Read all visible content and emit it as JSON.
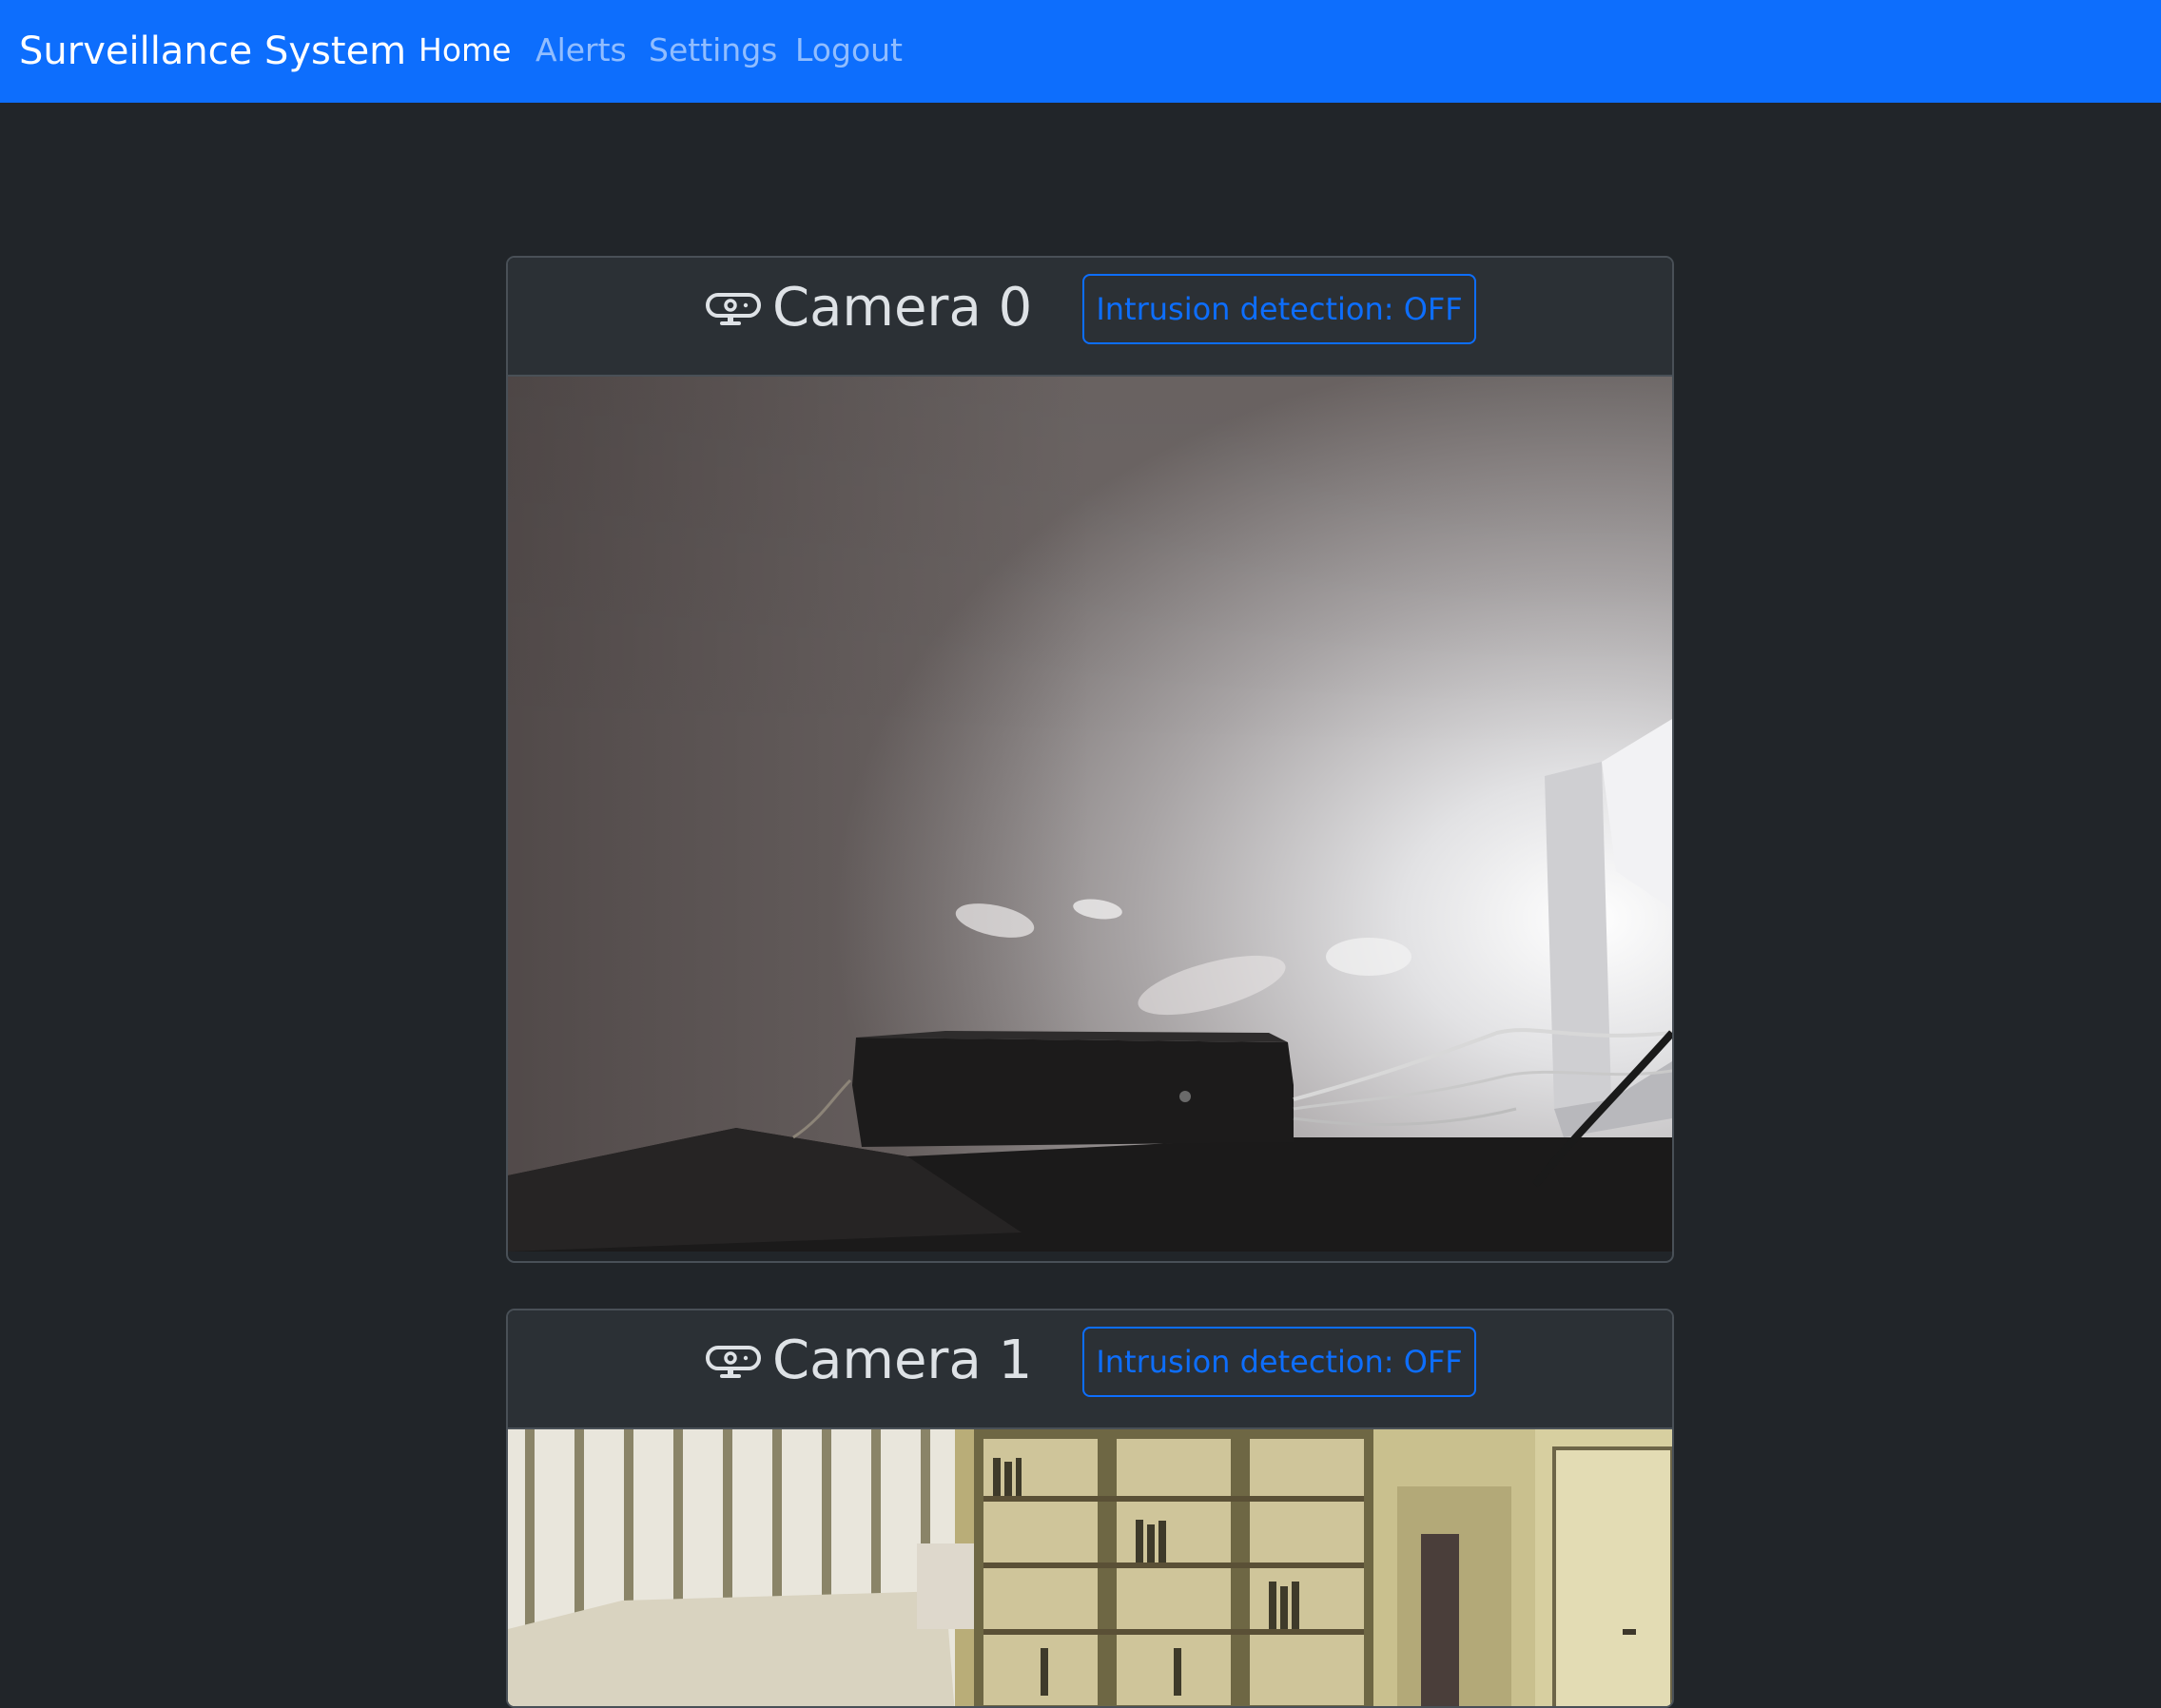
{
  "navbar": {
    "brand": "Surveillance System",
    "links": [
      {
        "label": "Home",
        "active": true
      },
      {
        "label": "Alerts",
        "active": false
      },
      {
        "label": "Settings",
        "active": false
      },
      {
        "label": "Logout",
        "active": false
      }
    ],
    "background_color": "#0d6efd"
  },
  "cameras": [
    {
      "title": "Camera 0",
      "icon": "webcam-icon",
      "intrusion_button_label": "Intrusion detection: OFF",
      "feed_description_icon": "camera-feed-image"
    },
    {
      "title": "Camera 1",
      "icon": "webcam-icon",
      "intrusion_button_label": "Intrusion detection: OFF",
      "feed_description_icon": "camera-feed-image"
    }
  ],
  "colors": {
    "page_background": "#212529",
    "card_header": "#2b3035",
    "accent": "#0d6efd"
  }
}
